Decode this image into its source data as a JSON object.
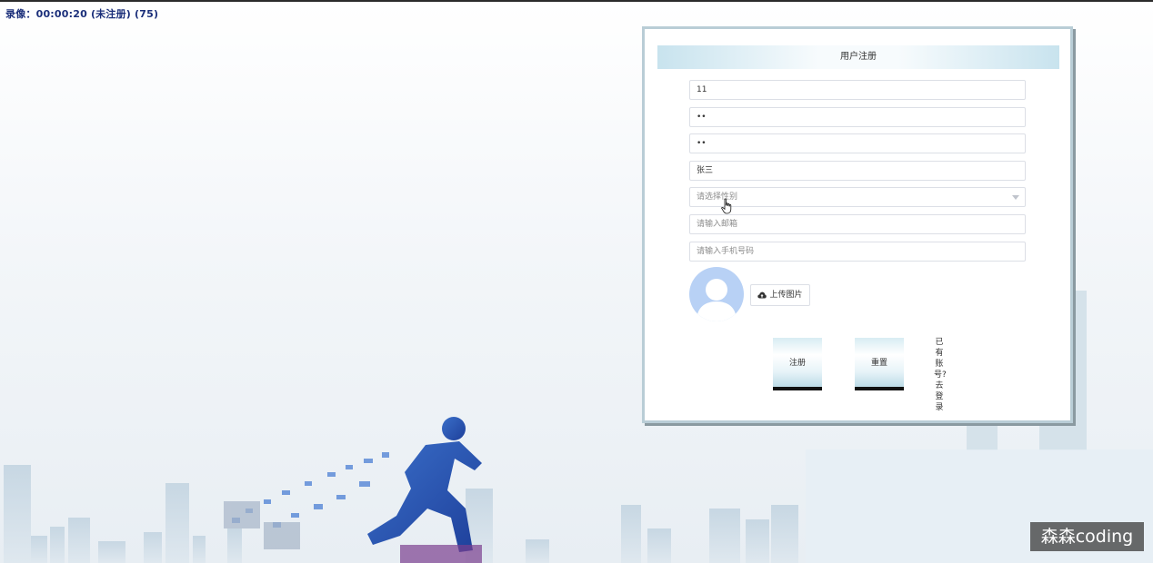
{
  "recording_label": "录像：00:00:20 (未注册) (75)",
  "form": {
    "title": "用户注册",
    "fields": [
      {
        "name": "username",
        "value": "11",
        "placeholder": ""
      },
      {
        "name": "password",
        "value": "••",
        "placeholder": ""
      },
      {
        "name": "confirm-password",
        "value": "••",
        "placeholder": ""
      },
      {
        "name": "real-name",
        "value": "张三",
        "placeholder": ""
      },
      {
        "name": "gender",
        "value": "",
        "placeholder": "请选择性别"
      },
      {
        "name": "email",
        "value": "",
        "placeholder": "请输入邮箱"
      },
      {
        "name": "phone",
        "value": "",
        "placeholder": "请输入手机号码"
      }
    ],
    "upload_label": "上传图片",
    "register_label": "注册",
    "reset_label": "重置",
    "login_link": "已有账号?去登录"
  },
  "watermark": "森森coding",
  "colors": {
    "panel_border": "#b9cdd6",
    "header_gradient": "#c8e3ee",
    "avatar": "#b8d1f5"
  }
}
